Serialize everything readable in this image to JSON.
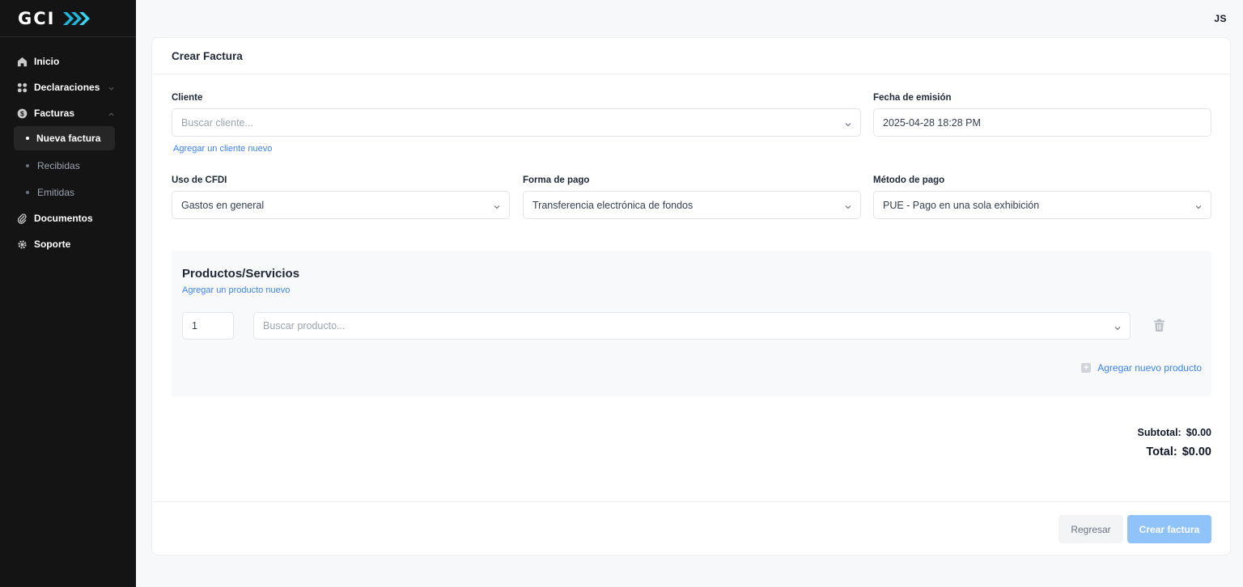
{
  "brand": {
    "logo_text": "GCI"
  },
  "user": {
    "initials": "JS"
  },
  "sidebar": {
    "items": [
      {
        "label": "Inicio"
      },
      {
        "label": "Declaraciones"
      },
      {
        "label": "Facturas"
      },
      {
        "label": "Documentos"
      },
      {
        "label": "Soporte"
      }
    ],
    "sub_items": [
      {
        "label": "Nueva factura"
      },
      {
        "label": "Recibidas"
      },
      {
        "label": "Emitidas"
      }
    ]
  },
  "form": {
    "title": "Crear Factura",
    "cliente": {
      "label": "Cliente",
      "placeholder": "Buscar cliente...",
      "add_link": "Agregar un cliente nuevo"
    },
    "fecha": {
      "label": "Fecha de emisión",
      "value": "2025-04-28 18:28 PM"
    },
    "uso_cfdi": {
      "label": "Uso de CFDI",
      "value": "Gastos en general"
    },
    "forma_pago": {
      "label": "Forma de pago",
      "value": "Transferencia electrónica de fondos"
    },
    "metodo_pago": {
      "label": "Método de pago",
      "value": "PUE - Pago en una sola exhibición"
    }
  },
  "products": {
    "title": "Productos/Servicios",
    "add_link": "Agregar un producto nuevo",
    "rows": [
      {
        "quantity": "1",
        "placeholder": "Buscar producto..."
      }
    ],
    "add_row_label": "Agregar nuevo producto"
  },
  "totals": {
    "subtotal_label": "Subtotal:",
    "subtotal_value": "$0.00",
    "total_label": "Total:",
    "total_value": "$0.00"
  },
  "actions": {
    "back_label": "Regresar",
    "create_label": "Crear factura"
  },
  "colors": {
    "sidebar_bg": "#141414",
    "accent": "#3b82f6",
    "primary_button": "#8fc3f9",
    "logo_arrows": "#1fb6d9"
  }
}
